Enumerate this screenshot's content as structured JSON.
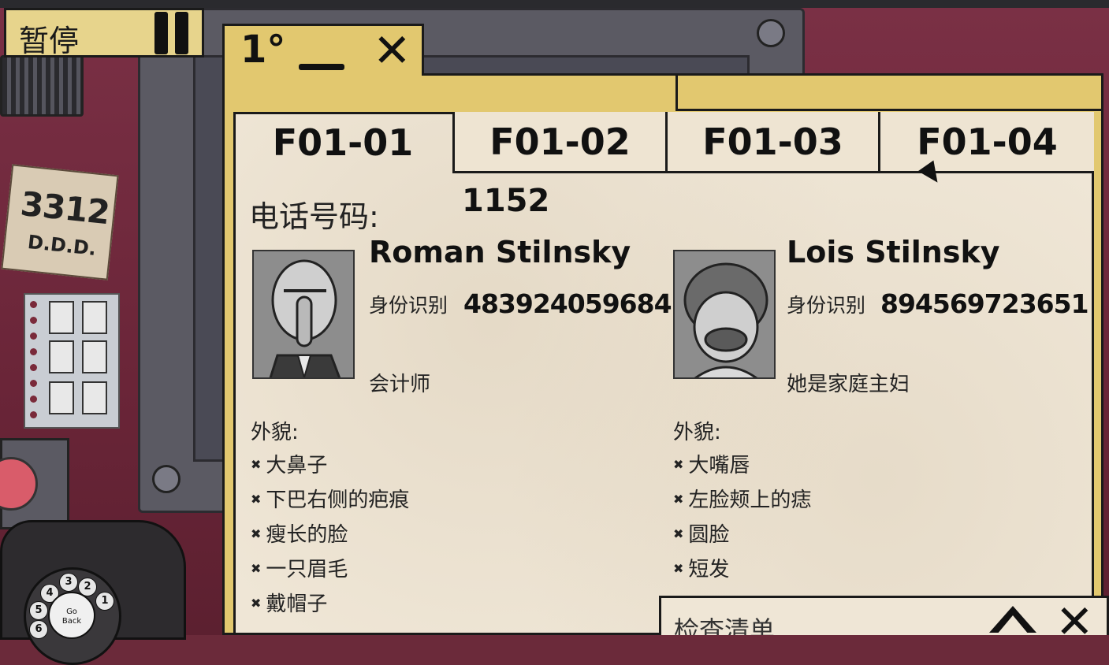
{
  "pause": {
    "label": "暂停",
    "icon": "pause-icon"
  },
  "background": {
    "note_number": "3312",
    "note_code": "D.D.D.",
    "dial_center": "Go\nBack",
    "dial_numbers": [
      "3",
      "2",
      "1",
      "4",
      "5",
      "6"
    ]
  },
  "window": {
    "floor": "1°",
    "tabs": [
      {
        "label": "F01-01",
        "active": true
      },
      {
        "label": "F01-02",
        "active": false
      },
      {
        "label": "F01-03",
        "active": false
      },
      {
        "label": "F01-04",
        "active": false
      }
    ]
  },
  "apartment": {
    "phone_label": "电话号码:",
    "phone_number": "1152",
    "residents": [
      {
        "name": "Roman Stilnsky",
        "id_label": "身份识别",
        "id_number": "483924059684",
        "occupation": "会计师",
        "appearance_label": "外貌:",
        "traits": [
          "大鼻子",
          "下巴右侧的疤痕",
          "瘦长的脸",
          "一只眉毛",
          "戴帽子"
        ]
      },
      {
        "name": "Lois Stilnsky",
        "id_label": "身份识别",
        "id_number": "894569723651",
        "occupation": "她是家庭主妇",
        "appearance_label": "外貌:",
        "traits": [
          "大嘴唇",
          "左脸颊上的痣",
          "圆脸",
          "短发"
        ]
      }
    ]
  },
  "checklist": {
    "title": "检查清单"
  },
  "colors": {
    "folder": "#e2c86f",
    "paper": "#efe6d6",
    "wall": "#6b2a3a",
    "ink": "#111111"
  }
}
